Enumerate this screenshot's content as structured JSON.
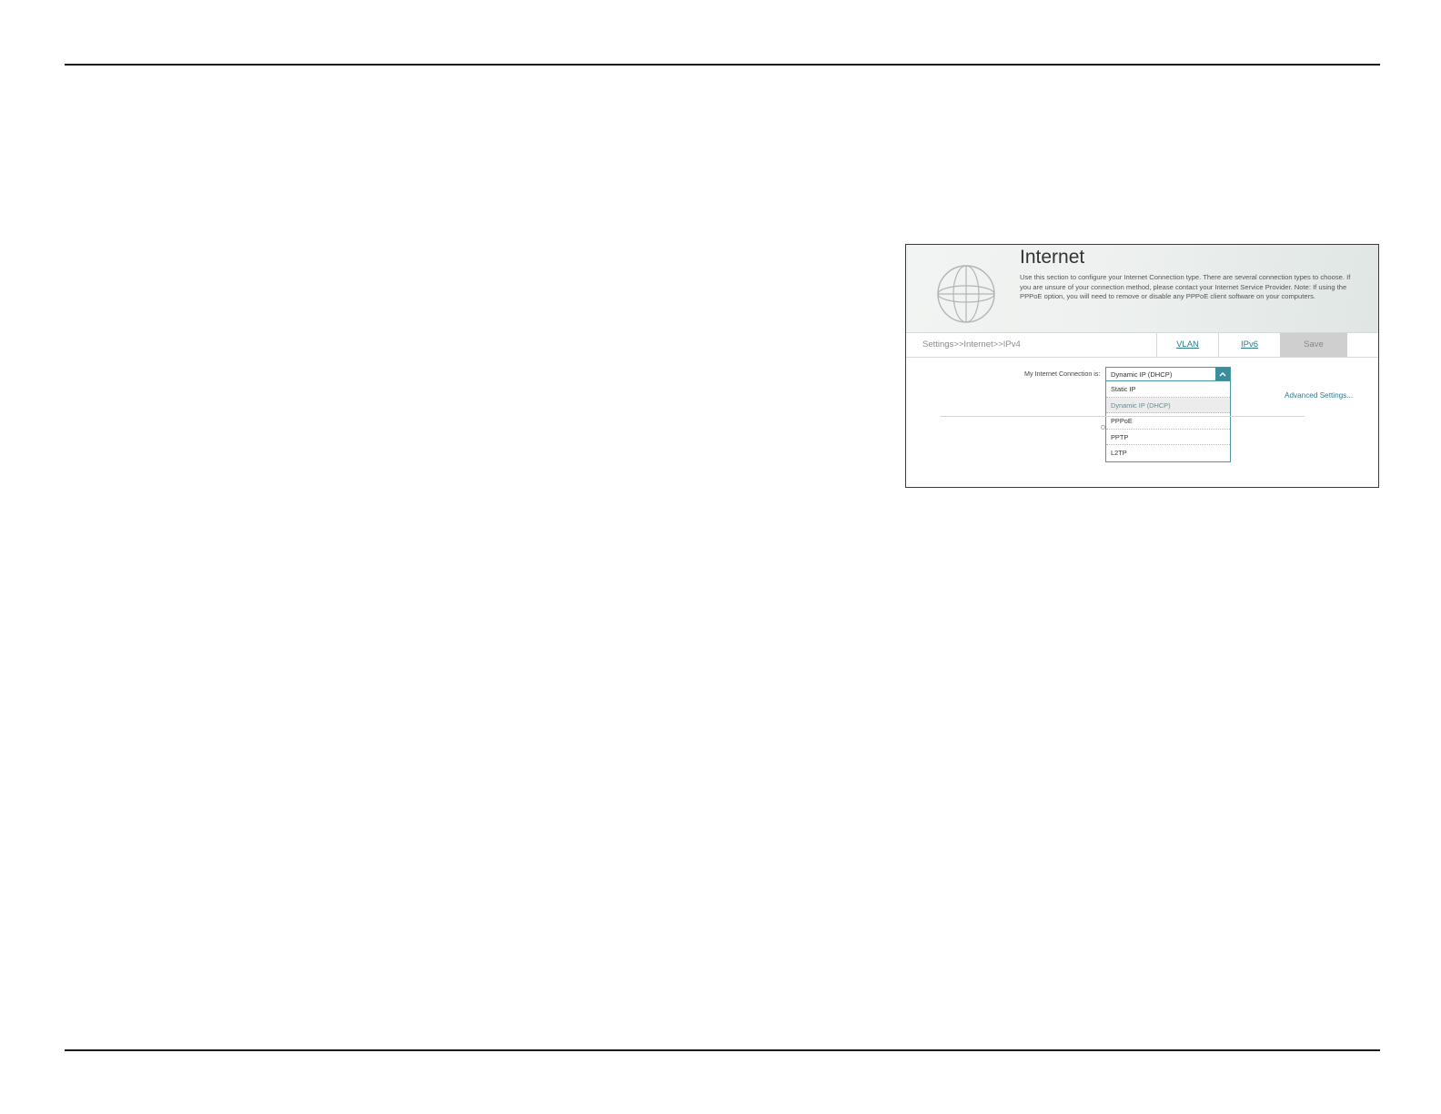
{
  "panel": {
    "title": "Internet",
    "description": "Use this section to configure your Internet Connection type. There are several connection types to choose. If you are unsure of your connection method, please contact your Internet Service Provider. Note: If using the PPPoE option, you will need to remove or disable any PPPoE client software on your computers.",
    "icon": "globe-icon"
  },
  "navbar": {
    "breadcrumb": "Settings>>Internet>>IPv4",
    "tabs": [
      {
        "label": "VLAN"
      },
      {
        "label": "IPv6"
      }
    ],
    "save_label": "Save"
  },
  "form": {
    "connection_label": "My Internet Connection is:",
    "connection_value": "Dynamic IP (DHCP)",
    "options": [
      {
        "label": "Static IP"
      },
      {
        "label": "Dynamic IP (DHCP)",
        "selected": true
      },
      {
        "label": "PPPoE"
      },
      {
        "label": "PPTP"
      },
      {
        "label": "L2TP"
      }
    ],
    "advanced_link": "Advanced Settings..."
  },
  "colors": {
    "accent": "#3a8e9c",
    "link": "#2b7c8c",
    "save_bg": "#cfcfcf"
  }
}
